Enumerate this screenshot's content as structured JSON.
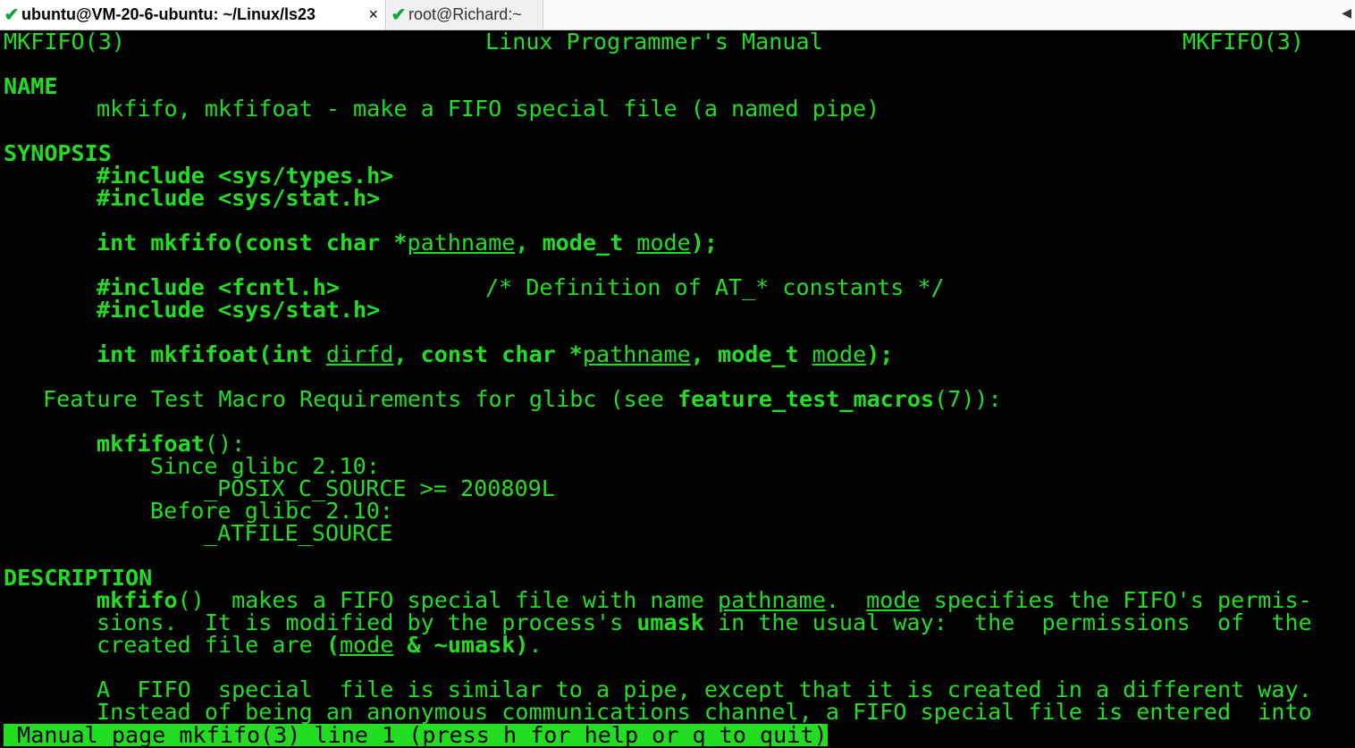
{
  "tabs": [
    {
      "label": "ubuntu@VM-20-6-ubuntu: ~/Linux/ls23",
      "active": true,
      "close": "×"
    },
    {
      "label": "root@Richard:~",
      "active": false
    }
  ],
  "terminal": {
    "fg_color": "#22dd22",
    "bg_color": "#000000",
    "header": {
      "left": "MKFIFO(3)",
      "center": "Linux Programmer's Manual",
      "right": "MKFIFO(3)"
    },
    "name_heading": "NAME",
    "name_text": "mkfifo, mkfifoat - make a FIFO special file (a named pipe)",
    "synopsis_heading": "SYNOPSIS",
    "syn": {
      "inc1": "#include <sys/types.h>",
      "inc2": "#include <sys/stat.h>",
      "proto1_a": "int mkfifo(const char *",
      "proto1_pathname": "pathname",
      "proto1_b": ", mode_t ",
      "proto1_mode": "mode",
      "proto1_c": ");",
      "inc3": "#include <fcntl.h>",
      "inc3_comment": "/* Definition of AT_* constants */",
      "inc4": "#include <sys/stat.h>",
      "proto2_a": "int mkfifoat(int ",
      "proto2_dirfd": "dirfd",
      "proto2_b": ", const char *",
      "proto2_pathname": "pathname",
      "proto2_c": ", mode_t ",
      "proto2_mode": "mode",
      "proto2_d": ");"
    },
    "ftm": {
      "prefix": "Feature Test Macro Requirements for glibc (see ",
      "link": "feature_test_macros",
      "suffix": "(7)):",
      "func": "mkfifoat",
      "func_suffix": "():",
      "since": "Since glibc 2.10:",
      "since_val": "_POSIX_C_SOURCE >= 200809L",
      "before": "Before glibc 2.10:",
      "before_val": "_ATFILE_SOURCE"
    },
    "description_heading": "DESCRIPTION",
    "desc": {
      "l1_func": "mkfifo",
      "l1_a": "()  makes a FIFO special file with name ",
      "l1_pathname": "pathname",
      "l1_b": ".  ",
      "l1_mode": "mode",
      "l1_c": " specifies the FIFO's permis‐",
      "l2_a": "sions.  It is modified by the process's ",
      "l2_umask": "umask",
      "l2_b": " in the usual way:  the  permissions  of  the",
      "l3_a": "created file are ",
      "l3_paren": "(",
      "l3_mode": "mode",
      "l3_b": " & ~umask)",
      "l3_c": ".",
      "l4": "A  FIFO  special  file is similar to a pipe, except that it is created in a different way.",
      "l5": "Instead of being an anonymous communications channel, a FIFO special file is entered  into"
    },
    "status": " Manual page mkfifo(3) line 1 (press h for help or q to quit)"
  }
}
